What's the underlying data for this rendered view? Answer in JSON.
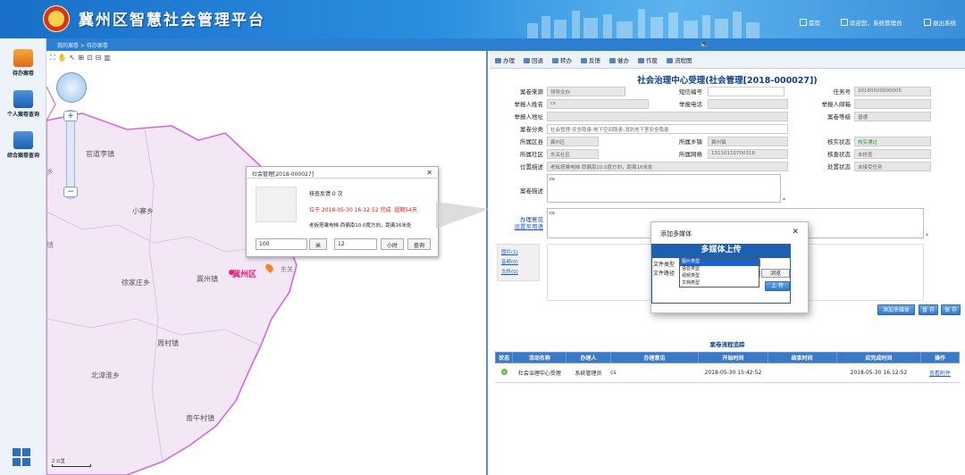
{
  "app": {
    "title": "冀州区智慧社会管理平台"
  },
  "header_nav": {
    "home": "首页",
    "welcome": "欢迎您，系统管理员",
    "logout": "退出系统"
  },
  "sidebar": {
    "items": [
      {
        "label": "待办案卷",
        "icon": "pending-cases-icon"
      },
      {
        "label": "个人案卷查询",
        "icon": "personal-query-icon"
      },
      {
        "label": "综合案卷查询",
        "icon": "integrated-query-icon"
      }
    ]
  },
  "breadcrumb": "我的案卷 > 待办案卷",
  "map": {
    "places": [
      "官道李镇",
      "小寨乡",
      "徐家庄乡",
      "冀州镇",
      "周村镇",
      "北漳淮乡",
      "南午村镇",
      "门庄乡"
    ],
    "labels": {
      "district": "冀州区",
      "pin_label": "东关"
    },
    "scale": "2 公里"
  },
  "popup": {
    "title": "社会管理[2018-000027]",
    "feedback": "核查反馈 0 次",
    "status_line_a": "位于 2018-05-30 16:12:52 完成",
    "status_line_b": "超期54天",
    "address": "老板搭乘电梯 西偏南10.0度方向，距离16米处",
    "distance_value": "100",
    "distance_unit": "米",
    "time_value": "12",
    "time_unit": "小时",
    "query_button": "查询"
  },
  "toolbar": {
    "items": [
      "办理",
      "回退",
      "转办",
      "反馈",
      "催办",
      "作废",
      "流程图"
    ]
  },
  "form": {
    "title": "社会治理中心受理(社会管理[2018-000027])",
    "labels": {
      "source": "案卷来源",
      "sms_no": "短信编号",
      "task_no": "任务号",
      "reporter": "举报人姓名",
      "phone": "举报电话",
      "email": "举报人邮箱",
      "address": "举报人地址",
      "level": "案卷等级",
      "category": "案卷分类",
      "district": "所属区县",
      "town": "所属乡镇",
      "verify": "核实状态",
      "community": "所属社区",
      "grid": "所属网格",
      "check": "核查状态",
      "location": "位置描述",
      "desc": "案卷描述",
      "opinion": "办理意见",
      "process": "处置状态"
    },
    "values": {
      "source": "领导交办",
      "task_no": "20180500000005",
      "reporter": "cs",
      "level": "普通",
      "category": "社会管理-安全隐患-地下空间隐患-消防地下室安全隐患",
      "district": "冀州区",
      "town": "冀州镇",
      "verify": "核实通过",
      "community": "东关社区",
      "grid": "13110110700318",
      "check": "未核查",
      "location": "老板搭乘电梯 西偏南10.0度方向，距离16米处",
      "process": "未接受任务",
      "desc": "cs",
      "opinion": "cs"
    },
    "set_common_link": "设置常用语",
    "attachment_links": [
      "图片(1)",
      "音频(0)",
      "文件(0)"
    ],
    "buttons": {
      "add_media": "添加多媒体",
      "save": "暂 存",
      "submit": "保 存"
    }
  },
  "track": {
    "title": "案卷流程追踪",
    "headers": [
      "状态",
      "活动名称",
      "办理人",
      "办理意见",
      "开始时间",
      "结束时间",
      "应完成时间",
      "操作"
    ],
    "rows": [
      {
        "activity": "社会治理中心受理",
        "handler": "系统管理员",
        "opinion": "cs",
        "start": "2018-05-30 15:42:52",
        "end": "",
        "due": "2018-05-30 16:12:52",
        "action": "查看附件"
      }
    ]
  },
  "modal": {
    "title": "添加多媒体",
    "upload_header": "多媒体上传",
    "file_type_label": "文件类型",
    "file_path_label": "文件路径",
    "options": [
      "图片类型",
      "语音类型",
      "视频类型",
      "文档类型"
    ],
    "browse_button": "浏览",
    "upload_button": "上 传"
  }
}
